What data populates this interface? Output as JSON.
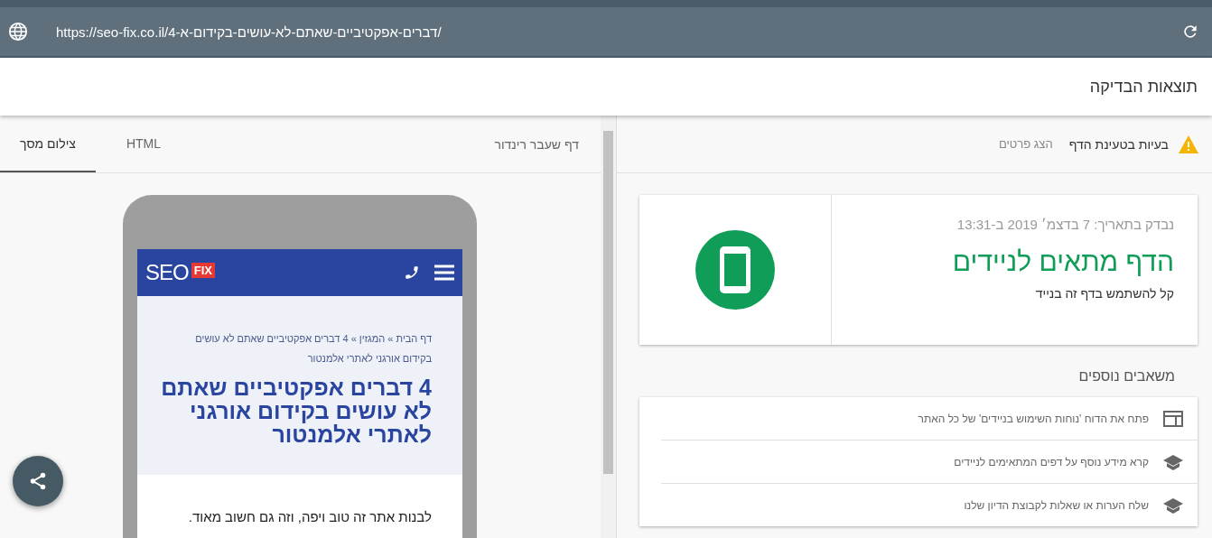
{
  "address_bar": {
    "url": "https://seo-fix.co.il/4-דברים-אפקטיביים-שאתם-לא-עושים-בקידום-א/"
  },
  "header": {
    "title": "תוצאות הבדיקה"
  },
  "preview": {
    "label": "דף שעבר רינדור",
    "tabs": [
      {
        "label": "HTML",
        "selected": false
      },
      {
        "label": "צילום מסך",
        "selected": true
      }
    ],
    "phone": {
      "logo": "SEO",
      "logo_badge": "FIX",
      "breadcrumb": "דף הבית » המגזין » 4 דברים אפקטיביים שאתם לא עושים בקידום אורגני לאתרי אלמנטור",
      "headline": "4 דברים אפקטיביים שאתם לא עושים בקידום אורגני לאתרי אלמנטור",
      "body": "לבנות אתר זה טוב ויפה, וזה גם חשוב מאוד."
    }
  },
  "issues": {
    "text": "בעיות בטעינת הדף",
    "link": "הצג פרטים"
  },
  "result": {
    "date": "נבדק בתאריך: 7 בדצמ׳ 2019 ב-13:31",
    "verdict": "הדף מתאים לניידים",
    "subtitle": "קל להשתמש בדף זה בנייד",
    "mobile_friendly": true
  },
  "resources": {
    "title": "משאבים נוספים",
    "items": [
      {
        "kind": "report",
        "text": "פתח את הדוח 'נוחות השימוש בניידים' של כל האתר"
      },
      {
        "kind": "learn",
        "text": "קרא מידע נוסף על דפים המתאימים לניידים"
      },
      {
        "kind": "learn",
        "text": "שלח הערות או שאלות לקבוצת הדיון שלנו"
      }
    ]
  }
}
